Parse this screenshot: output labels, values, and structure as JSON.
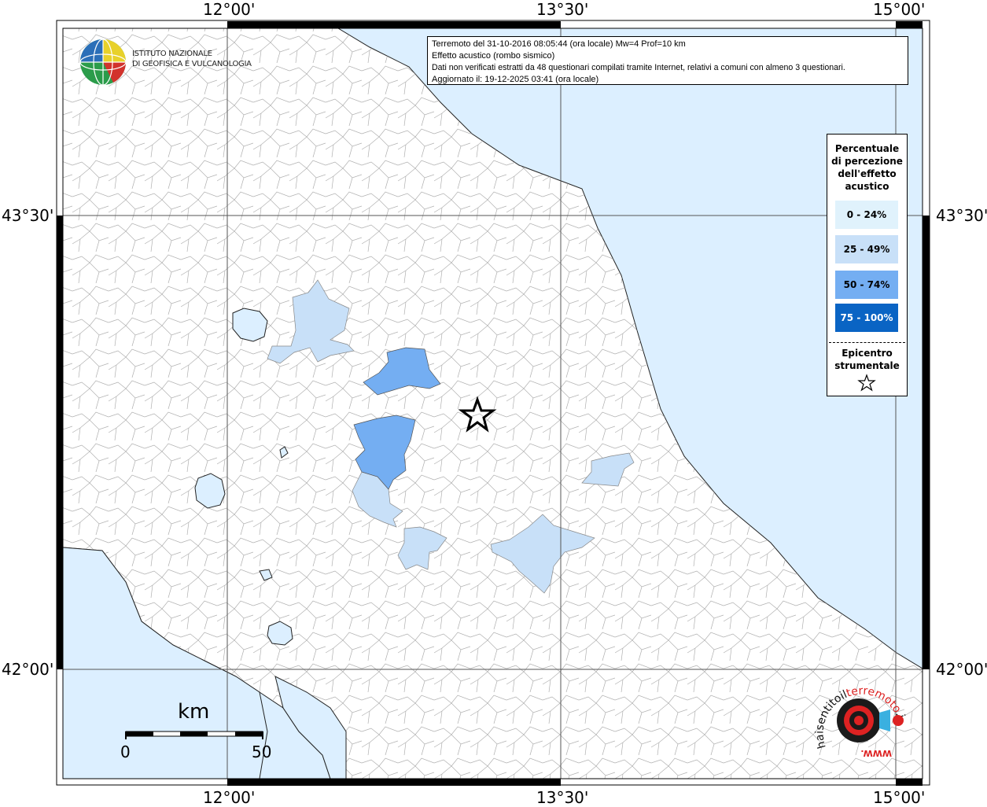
{
  "info": {
    "line1": "Terremoto del 31-10-2016 08:05:44 (ora locale) Mw=4 Prof=10 km",
    "line2": "Effetto acustico (rombo sismico)",
    "line3": "Dati non verificati estratti da 48 questionari compilati tramite Internet, relativi a comuni con almeno 3 questionari.",
    "line4": "Aggiornato il: 19-12-2025 03:41 (ora locale)"
  },
  "axes": {
    "lon_labels": [
      "12°00'",
      "13°30'",
      "15°00'"
    ],
    "lat_labels": [
      "43°30'",
      "42°00'"
    ]
  },
  "legend": {
    "title_lines": [
      "Percentuale",
      "di percezione",
      "dell'effetto",
      "acustico"
    ],
    "classes": [
      {
        "label": "0 - 24%",
        "color": "#e0f2fc",
        "text_color": "#000000"
      },
      {
        "label": "25 - 49%",
        "color": "#c8e0f8",
        "text_color": "#000000"
      },
      {
        "label": "50 - 74%",
        "color": "#74aef2",
        "text_color": "#000000"
      },
      {
        "label": "75 - 100%",
        "color": "#0a64c4",
        "text_color": "#ffffff"
      }
    ],
    "epicenter_lines": [
      "Epicentro",
      "strumentale"
    ]
  },
  "scalebar": {
    "unit": "km",
    "min": "0",
    "max": "50"
  },
  "logos": {
    "ingv_line1": "ISTITUTO NAZIONALE",
    "ingv_line2": "DI GEOFISICA E VULCANOLOGIA",
    "hst_text": "haisentitoilterremoto.it",
    "hst_www": "WWW.",
    "ingv_name": "ingv-logo",
    "hst_name": "hai-sentito-il-terremoto-logo"
  },
  "colors": {
    "sea": "#dcefff",
    "land": "#ffffff",
    "grid": "#555555",
    "border": "#999999"
  }
}
